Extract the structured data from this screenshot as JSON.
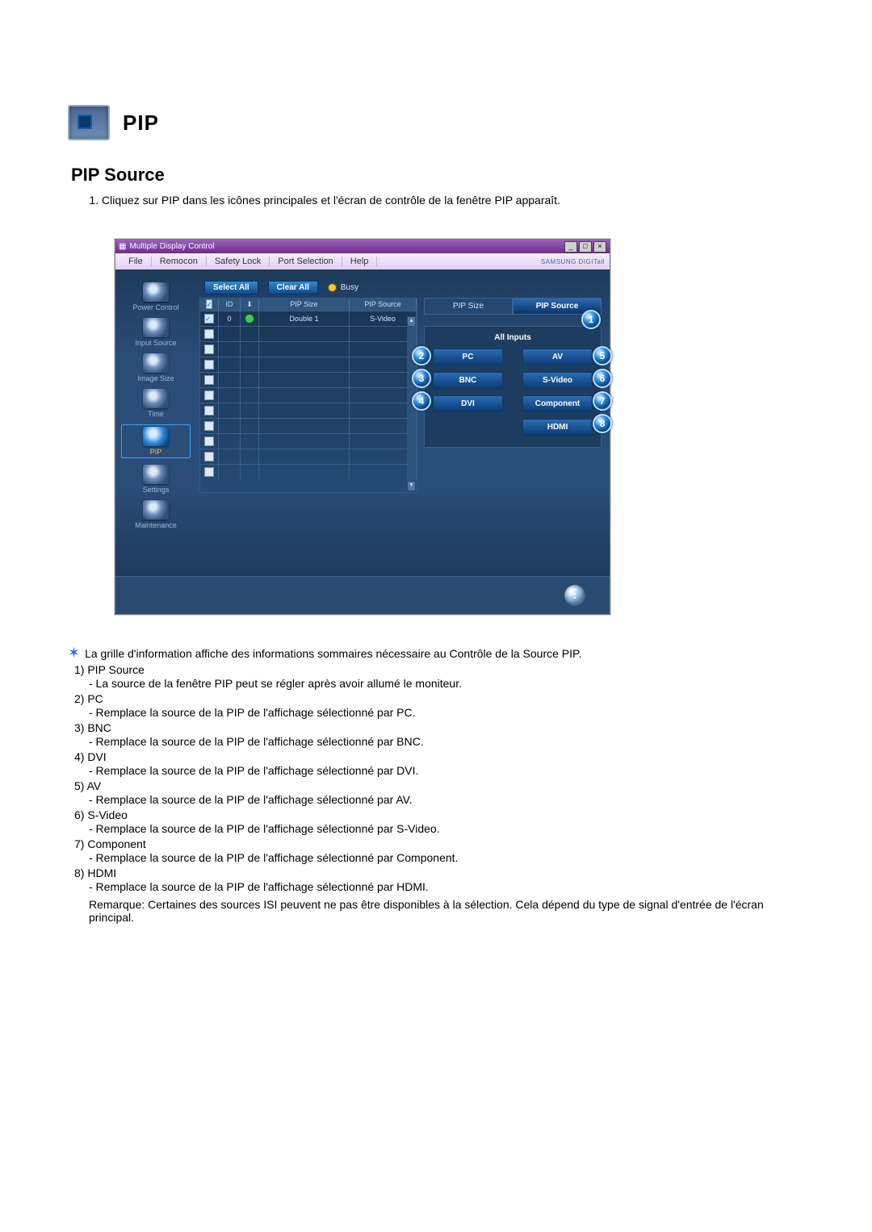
{
  "title": "PIP",
  "section_heading": "PIP Source",
  "instruction_1": "Cliquez sur PIP dans les icônes principales et l'écran de contrôle de la fenêtre PIP apparaît.",
  "app": {
    "window_title": "Multiple Display Control",
    "brand": "SAMSUNG DIGITall",
    "menu": {
      "file": "File",
      "remocon": "Remocon",
      "safety": "Safety Lock",
      "port": "Port Selection",
      "help": "Help"
    },
    "toolbar": {
      "select_all": "Select All",
      "clear_all": "Clear All",
      "busy": "Busy"
    },
    "sidebar": {
      "power": "Power Control",
      "input": "Input Source",
      "image": "Image Size",
      "time": "Time",
      "pip": "PIP",
      "settings": "Settings",
      "maintenance": "Maintenance"
    },
    "grid": {
      "col_id": "ID",
      "col_pip_size": "PIP Size",
      "col_pip_source": "PIP Source",
      "row_id": "0",
      "row_size": "Double 1",
      "row_src": "S-Video"
    },
    "tabs": {
      "size": "PIP Size",
      "source": "PIP Source"
    },
    "panel_title": "All Inputs",
    "sources": {
      "pc": "PC",
      "bnc": "BNC",
      "dvi": "DVI",
      "av": "AV",
      "svideo": "S-Video",
      "component": "Component",
      "hdmi": "HDMI"
    },
    "callouts": {
      "n1": "1",
      "n2": "2",
      "n3": "3",
      "n4": "4",
      "n5": "5",
      "n6": "6",
      "n7": "7",
      "n8": "8"
    }
  },
  "star_text": "La grille d'information affiche des informations sommaires nécessaire au Contrôle de la Source PIP.",
  "items": {
    "i1": {
      "n": "1)",
      "h": "PIP Source",
      "b": "- La source de la fenêtre PIP peut se régler après avoir allumé le moniteur."
    },
    "i2": {
      "n": "2)",
      "h": "PC",
      "b": "- Remplace la source de la PIP de l'affichage sélectionné par PC."
    },
    "i3": {
      "n": "3)",
      "h": "BNC",
      "b": "- Remplace la source de la PIP de l'affichage sélectionné par BNC."
    },
    "i4": {
      "n": "4)",
      "h": "DVI",
      "b": "- Remplace la source de la PIP de l'affichage sélectionné par DVI."
    },
    "i5": {
      "n": "5)",
      "h": "AV",
      "b": "- Remplace la source de la PIP de l'affichage sélectionné par AV."
    },
    "i6": {
      "n": "6)",
      "h": "S-Video",
      "b": "- Remplace la source de la PIP de l'affichage sélectionné par S-Video."
    },
    "i7": {
      "n": "7)",
      "h": "Component",
      "b": "- Remplace la source de la PIP de l'affichage sélectionné par Component."
    },
    "i8": {
      "n": "8)",
      "h": "HDMI",
      "b": "- Remplace la source de la PIP de l'affichage sélectionné par HDMI."
    }
  },
  "remark": "Remarque: Certaines des sources ISI peuvent ne pas être disponibles à la sélection. Cela dépend du type de signal d'entrée de l'écran principal."
}
